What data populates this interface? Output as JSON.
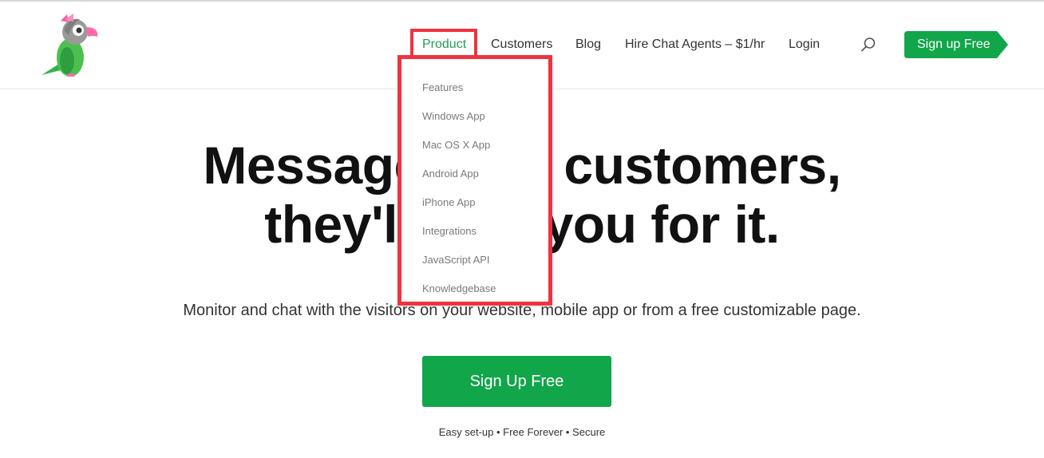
{
  "brand": {
    "logo_icon": "parrot-logo-icon",
    "colors": {
      "accent": "#1f9d55",
      "button": "#12a64b",
      "highlight": "#ef3340"
    }
  },
  "nav": {
    "product": "Product",
    "customers": "Customers",
    "blog": "Blog",
    "hire": "Hire Chat Agents – $1/hr",
    "login": "Login",
    "search_icon": "search-icon",
    "signup": "Sign up Free"
  },
  "product_menu": {
    "items": [
      "Features",
      "Windows App",
      "Mac OS X App",
      "Android App",
      "iPhone App",
      "Integrations",
      "JavaScript API",
      "Knowledgebase"
    ]
  },
  "hero": {
    "line1": "Message your customers,",
    "line2": "they'll love you for it.",
    "subtitle": "Monitor and chat with the visitors on your website, mobile app or from a free customizable page.",
    "cta": "Sign Up Free",
    "tagline": "Easy set-up • Free Forever • Secure"
  }
}
